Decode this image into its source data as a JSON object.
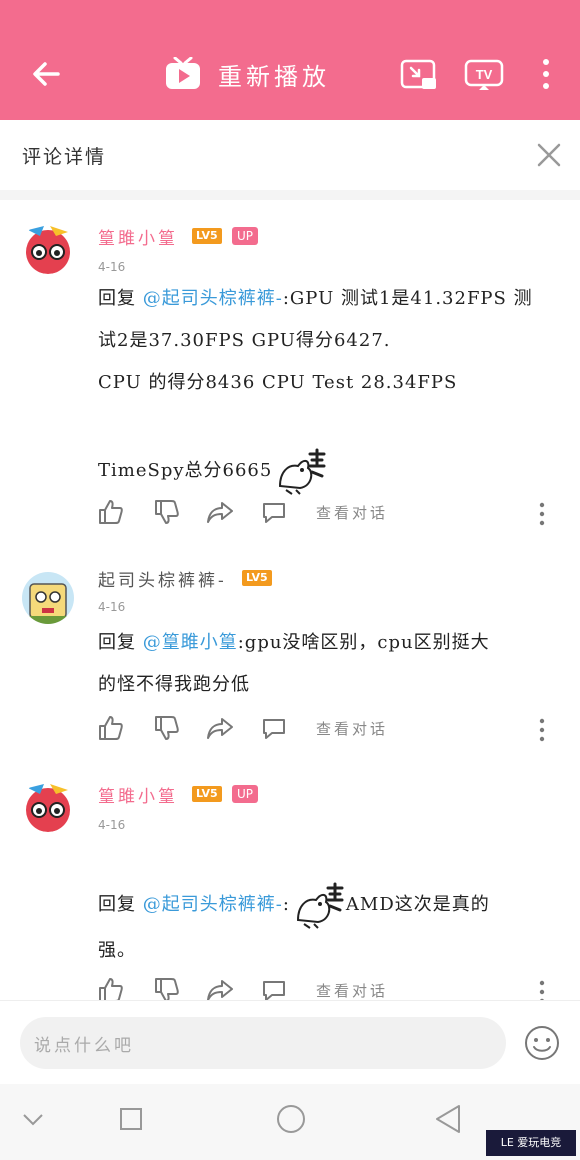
{
  "header": {
    "title": "重新播放",
    "icons": [
      "back-arrow-icon",
      "tv-logo-icon",
      "cast-screen-icon",
      "tv-cast-icon",
      "more-vertical-icon"
    ],
    "tv_label": "TV"
  },
  "detail": {
    "title": "评论详情",
    "close_icon": "close-icon"
  },
  "comments": [
    {
      "user": "篁雎小篁",
      "level": "LV5",
      "up": "UP",
      "date": "4-16",
      "reply_prefix": "回复 ",
      "mention": "@起司头棕裤裤-",
      "lines": [
        ":GPU 测试1是41.32FPS 测",
        "试2是37.30FPS GPU得分6427.",
        "CPU 的得分8436 CPU Test 28.34FPS",
        "",
        "TimeSpy总分6665"
      ],
      "view_dialog": "查看对话"
    },
    {
      "user": "起司头棕裤裤-",
      "level": "LV5",
      "date": "4-16",
      "reply_prefix": "回复 ",
      "mention": "@篁雎小篁",
      "lines": [
        ":gpu没啥区别，cpu区别挺大",
        "的怪不得我跑分低"
      ],
      "view_dialog": "查看对话"
    },
    {
      "user": "篁雎小篁",
      "level": "LV5",
      "up": "UP",
      "date": "4-16",
      "reply_prefix": "回复 ",
      "mention": "@起司头棕裤裤-",
      "lines": [
        ":",
        "AMD这次是真的",
        "强。"
      ],
      "view_dialog": "查看对话"
    }
  ],
  "input": {
    "placeholder": "说点什么吧"
  },
  "watermark": "LE 爱玩电竞",
  "colors": {
    "accent": "#f36c8e",
    "mention": "#3a9ad9",
    "level": "#f39a1e"
  }
}
